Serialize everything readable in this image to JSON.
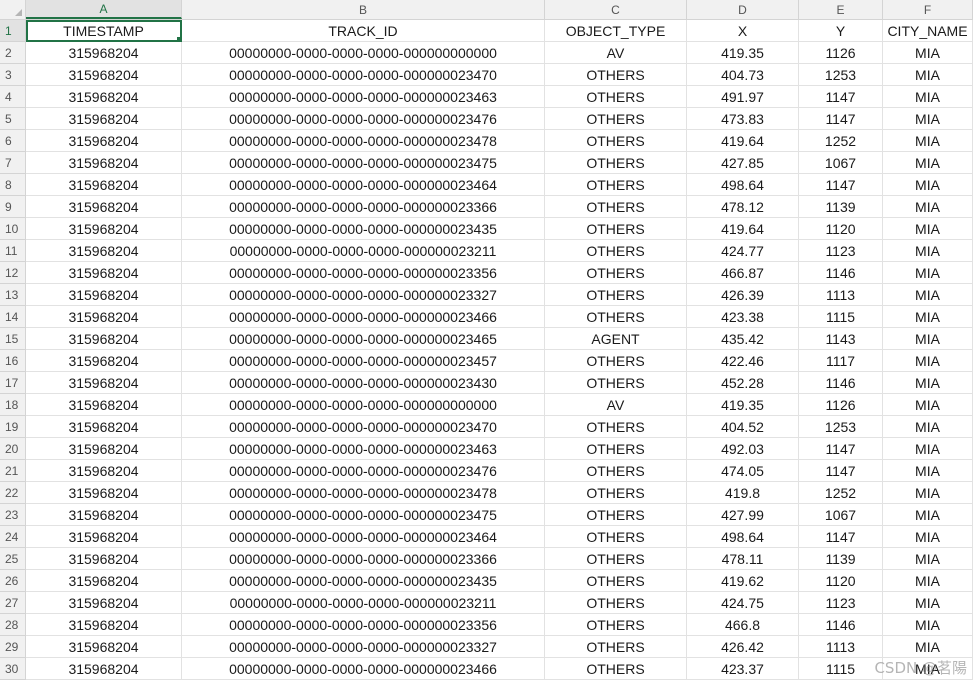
{
  "column_letters": [
    "A",
    "B",
    "C",
    "D",
    "E",
    "F"
  ],
  "selected_cell": "A1",
  "accent_color": "#217346",
  "row_numbers": [
    "1",
    "2",
    "3",
    "4",
    "5",
    "6",
    "7",
    "8",
    "9",
    "10",
    "11",
    "12",
    "13",
    "14",
    "15",
    "16",
    "17",
    "18",
    "19",
    "20",
    "21",
    "22",
    "23",
    "24",
    "25",
    "26",
    "27",
    "28",
    "29",
    "30"
  ],
  "header": [
    "TIMESTAMP",
    "TRACK_ID",
    "OBJECT_TYPE",
    "X",
    "Y",
    "CITY_NAME"
  ],
  "rows": [
    [
      "315968204",
      "00000000-0000-0000-0000-000000000000",
      "AV",
      "419.35",
      "1126",
      "MIA"
    ],
    [
      "315968204",
      "00000000-0000-0000-0000-000000023470",
      "OTHERS",
      "404.73",
      "1253",
      "MIA"
    ],
    [
      "315968204",
      "00000000-0000-0000-0000-000000023463",
      "OTHERS",
      "491.97",
      "1147",
      "MIA"
    ],
    [
      "315968204",
      "00000000-0000-0000-0000-000000023476",
      "OTHERS",
      "473.83",
      "1147",
      "MIA"
    ],
    [
      "315968204",
      "00000000-0000-0000-0000-000000023478",
      "OTHERS",
      "419.64",
      "1252",
      "MIA"
    ],
    [
      "315968204",
      "00000000-0000-0000-0000-000000023475",
      "OTHERS",
      "427.85",
      "1067",
      "MIA"
    ],
    [
      "315968204",
      "00000000-0000-0000-0000-000000023464",
      "OTHERS",
      "498.64",
      "1147",
      "MIA"
    ],
    [
      "315968204",
      "00000000-0000-0000-0000-000000023366",
      "OTHERS",
      "478.12",
      "1139",
      "MIA"
    ],
    [
      "315968204",
      "00000000-0000-0000-0000-000000023435",
      "OTHERS",
      "419.64",
      "1120",
      "MIA"
    ],
    [
      "315968204",
      "00000000-0000-0000-0000-000000023211",
      "OTHERS",
      "424.77",
      "1123",
      "MIA"
    ],
    [
      "315968204",
      "00000000-0000-0000-0000-000000023356",
      "OTHERS",
      "466.87",
      "1146",
      "MIA"
    ],
    [
      "315968204",
      "00000000-0000-0000-0000-000000023327",
      "OTHERS",
      "426.39",
      "1113",
      "MIA"
    ],
    [
      "315968204",
      "00000000-0000-0000-0000-000000023466",
      "OTHERS",
      "423.38",
      "1115",
      "MIA"
    ],
    [
      "315968204",
      "00000000-0000-0000-0000-000000023465",
      "AGENT",
      "435.42",
      "1143",
      "MIA"
    ],
    [
      "315968204",
      "00000000-0000-0000-0000-000000023457",
      "OTHERS",
      "422.46",
      "1117",
      "MIA"
    ],
    [
      "315968204",
      "00000000-0000-0000-0000-000000023430",
      "OTHERS",
      "452.28",
      "1146",
      "MIA"
    ],
    [
      "315968204",
      "00000000-0000-0000-0000-000000000000",
      "AV",
      "419.35",
      "1126",
      "MIA"
    ],
    [
      "315968204",
      "00000000-0000-0000-0000-000000023470",
      "OTHERS",
      "404.52",
      "1253",
      "MIA"
    ],
    [
      "315968204",
      "00000000-0000-0000-0000-000000023463",
      "OTHERS",
      "492.03",
      "1147",
      "MIA"
    ],
    [
      "315968204",
      "00000000-0000-0000-0000-000000023476",
      "OTHERS",
      "474.05",
      "1147",
      "MIA"
    ],
    [
      "315968204",
      "00000000-0000-0000-0000-000000023478",
      "OTHERS",
      "419.8",
      "1252",
      "MIA"
    ],
    [
      "315968204",
      "00000000-0000-0000-0000-000000023475",
      "OTHERS",
      "427.99",
      "1067",
      "MIA"
    ],
    [
      "315968204",
      "00000000-0000-0000-0000-000000023464",
      "OTHERS",
      "498.64",
      "1147",
      "MIA"
    ],
    [
      "315968204",
      "00000000-0000-0000-0000-000000023366",
      "OTHERS",
      "478.11",
      "1139",
      "MIA"
    ],
    [
      "315968204",
      "00000000-0000-0000-0000-000000023435",
      "OTHERS",
      "419.62",
      "1120",
      "MIA"
    ],
    [
      "315968204",
      "00000000-0000-0000-0000-000000023211",
      "OTHERS",
      "424.75",
      "1123",
      "MIA"
    ],
    [
      "315968204",
      "00000000-0000-0000-0000-000000023356",
      "OTHERS",
      "466.8",
      "1146",
      "MIA"
    ],
    [
      "315968204",
      "00000000-0000-0000-0000-000000023327",
      "OTHERS",
      "426.42",
      "1113",
      "MIA"
    ],
    [
      "315968204",
      "00000000-0000-0000-0000-000000023466",
      "OTHERS",
      "423.37",
      "1115",
      "MIA"
    ]
  ],
  "watermark": "CSDN @茗陽"
}
